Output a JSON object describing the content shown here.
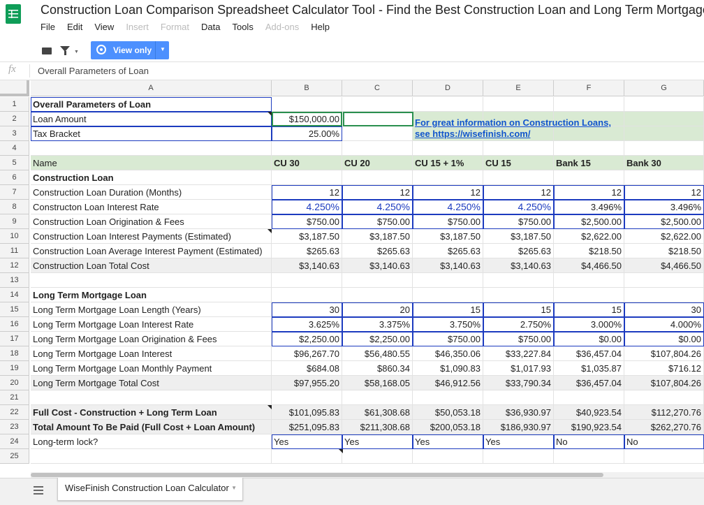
{
  "app": {
    "title": "Construction Loan Comparison Spreadsheet Calculator Tool - Find the Best Construction Loan and Long Term Mortgage",
    "menus": [
      {
        "label": "File",
        "disabled": false
      },
      {
        "label": "Edit",
        "disabled": false
      },
      {
        "label": "View",
        "disabled": false
      },
      {
        "label": "Insert",
        "disabled": true
      },
      {
        "label": "Format",
        "disabled": true
      },
      {
        "label": "Data",
        "disabled": false
      },
      {
        "label": "Tools",
        "disabled": false
      },
      {
        "label": "Add-ons",
        "disabled": true
      },
      {
        "label": "Help",
        "disabled": false
      }
    ],
    "view_mode_label": "View only",
    "fx_symbol": "fx",
    "formula_value": "Overall Parameters of Loan",
    "sheet_tab": "WiseFinish Construction Loan Calculator",
    "brand_color": "#0f9d58",
    "accent_color": "#4d90fe"
  },
  "grid": {
    "columns": [
      "A",
      "B",
      "C",
      "D",
      "E",
      "F",
      "G"
    ],
    "link_text": "For great information on Construction Loans, see https://wisefinish.com/",
    "rows": [
      {
        "n": "1",
        "a": "Overall Parameters of Loan",
        "v": []
      },
      {
        "n": "2",
        "a": "Loan Amount",
        "v": [
          "$150,000.00",
          "",
          "",
          "",
          "",
          ""
        ]
      },
      {
        "n": "3",
        "a": "Tax Bracket",
        "v": [
          "25.00%",
          "",
          "",
          "",
          "",
          ""
        ]
      },
      {
        "n": "4",
        "a": "",
        "v": []
      },
      {
        "n": "5",
        "a": "Name",
        "v": [
          "CU 30",
          "CU 20",
          "CU 15 + 1%",
          "CU 15",
          "Bank 15",
          "Bank 30"
        ]
      },
      {
        "n": "6",
        "a": "Construction Loan",
        "v": []
      },
      {
        "n": "7",
        "a": "Construction Loan Duration (Months)",
        "v": [
          "12",
          "12",
          "12",
          "12",
          "12",
          "12"
        ]
      },
      {
        "n": "8",
        "a": "Constructon Loan Interest Rate",
        "v": [
          "4.250%",
          "4.250%",
          "4.250%",
          "4.250%",
          "3.496%",
          "3.496%"
        ]
      },
      {
        "n": "9",
        "a": "Construction Loan Origination & Fees",
        "v": [
          "$750.00",
          "$750.00",
          "$750.00",
          "$750.00",
          "$2,500.00",
          "$2,500.00"
        ]
      },
      {
        "n": "10",
        "a": "Construction Loan Interest Payments (Estimated)",
        "v": [
          "$3,187.50",
          "$3,187.50",
          "$3,187.50",
          "$3,187.50",
          "$2,622.00",
          "$2,622.00"
        ]
      },
      {
        "n": "11",
        "a": "Construction Loan Average Interest Payment (Estimated)",
        "v": [
          "$265.63",
          "$265.63",
          "$265.63",
          "$265.63",
          "$218.50",
          "$218.50"
        ]
      },
      {
        "n": "12",
        "a": "Construction Loan Total Cost",
        "v": [
          "$3,140.63",
          "$3,140.63",
          "$3,140.63",
          "$3,140.63",
          "$4,466.50",
          "$4,466.50"
        ]
      },
      {
        "n": "13",
        "a": "",
        "v": []
      },
      {
        "n": "14",
        "a": "Long Term Mortgage Loan",
        "v": []
      },
      {
        "n": "15",
        "a": "Long Term Mortgage Loan Length (Years)",
        "v": [
          "30",
          "20",
          "15",
          "15",
          "15",
          "30"
        ]
      },
      {
        "n": "16",
        "a": "Long Term Mortgage Loan Interest Rate",
        "v": [
          "3.625%",
          "3.375%",
          "3.750%",
          "2.750%",
          "3.000%",
          "4.000%"
        ]
      },
      {
        "n": "17",
        "a": "Long Term Mortgage Loan Origination & Fees",
        "v": [
          "$2,250.00",
          "$2,250.00",
          "$750.00",
          "$750.00",
          "$0.00",
          "$0.00"
        ]
      },
      {
        "n": "18",
        "a": "Long Term Mortgage Loan Interest",
        "v": [
          "$96,267.70",
          "$56,480.55",
          "$46,350.06",
          "$33,227.84",
          "$36,457.04",
          "$107,804.26"
        ]
      },
      {
        "n": "19",
        "a": "Long Term Mortgage Loan Monthly Payment",
        "v": [
          "$684.08",
          "$860.34",
          "$1,090.83",
          "$1,017.93",
          "$1,035.87",
          "$716.12"
        ]
      },
      {
        "n": "20",
        "a": "Long Term Mortgage Total Cost",
        "v": [
          "$97,955.20",
          "$58,168.05",
          "$46,912.56",
          "$33,790.34",
          "$36,457.04",
          "$107,804.26"
        ]
      },
      {
        "n": "21",
        "a": "",
        "v": []
      },
      {
        "n": "22",
        "a": "Full Cost - Construction + Long Term Loan",
        "v": [
          "$101,095.83",
          "$61,308.68",
          "$50,053.18",
          "$36,930.97",
          "$40,923.54",
          "$112,270.76"
        ]
      },
      {
        "n": "23",
        "a": "Total Amount To Be Paid (Full Cost + Loan Amount)",
        "v": [
          "$251,095.83",
          "$211,308.68",
          "$200,053.18",
          "$186,930.97",
          "$190,923.54",
          "$262,270.76"
        ]
      },
      {
        "n": "24",
        "a": "Long-term lock?",
        "v": [
          "Yes",
          "Yes",
          "Yes",
          "Yes",
          "No",
          "No"
        ]
      },
      {
        "n": "25",
        "a": "",
        "v": []
      }
    ]
  }
}
